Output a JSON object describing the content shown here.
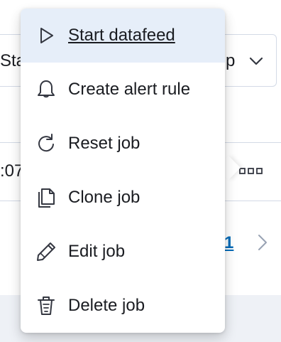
{
  "background": {
    "toolbar_left_text": "Sta",
    "toolbar_right_text": "p",
    "row_text": ":07",
    "pagination_current": "1"
  },
  "menu": {
    "items": [
      {
        "label": "Start datafeed",
        "icon": "play-icon",
        "active": true
      },
      {
        "label": "Create alert rule",
        "icon": "bell-icon"
      },
      {
        "label": "Reset job",
        "icon": "refresh-icon"
      },
      {
        "label": "Clone job",
        "icon": "copy-icon"
      },
      {
        "label": "Edit job",
        "icon": "pencil-icon"
      },
      {
        "label": "Delete job",
        "icon": "trash-icon"
      }
    ]
  },
  "colors": {
    "active_background": "#e6eef9",
    "link": "#006bb8",
    "text": "#1a1c21"
  }
}
